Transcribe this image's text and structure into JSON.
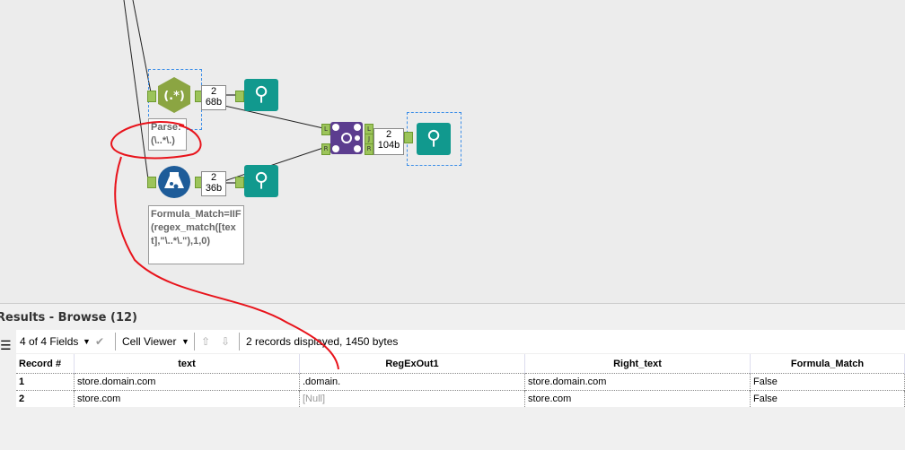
{
  "workflow": {
    "regex_tool": {
      "icon": "regex-icon",
      "glyph": "(.*)",
      "annotation": "Parse:\n(\\..*\\.)",
      "count": "2",
      "size": "68b"
    },
    "formula_tool": {
      "icon": "formula-flask-icon",
      "annotation": "Formula_Match=IIF(regex_match([text],\"\\..*\\.\"),1,0)",
      "count": "2",
      "size": "36b"
    },
    "join_tool": {
      "icon": "join-icon",
      "inputs": [
        "L",
        "R"
      ],
      "outputs": [
        "L",
        "J",
        "R"
      ],
      "count": "2",
      "size": "104b"
    },
    "browse_icon": "binoculars-icon"
  },
  "results": {
    "title": "Results - Browse (12)",
    "fields_select": "4 of 4 Fields",
    "viewer_select": "Cell Viewer",
    "status": "2 records displayed, 1450 bytes",
    "columns": [
      "Record #",
      "text",
      "RegExOut1",
      "Right_text",
      "Formula_Match"
    ],
    "rows": [
      [
        "1",
        "store.domain.com",
        ".domain.",
        "store.domain.com",
        "False"
      ],
      [
        "2",
        "store.com",
        "[Null]",
        "store.com",
        "False"
      ]
    ]
  },
  "colors": {
    "annotation_red": "#e8131b",
    "join": "#5c3d8f",
    "browse": "#11998e",
    "regex": "#8ba542",
    "formula": "#1e5c99"
  }
}
